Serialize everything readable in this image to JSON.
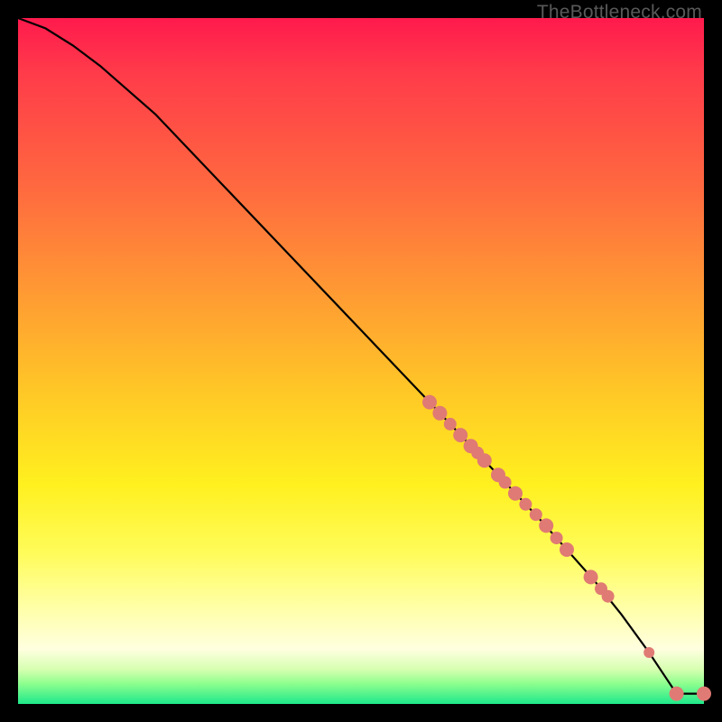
{
  "watermark": "TheBottleneck.com",
  "chart_data": {
    "type": "line",
    "title": "",
    "xlabel": "",
    "ylabel": "",
    "xlim": [
      0,
      100
    ],
    "ylim": [
      0,
      100
    ],
    "curve": {
      "x": [
        0,
        4,
        8,
        12,
        20,
        30,
        40,
        50,
        60,
        68,
        76,
        80,
        84,
        88,
        92,
        94,
        96,
        100
      ],
      "y": [
        100,
        98.5,
        96,
        93,
        86,
        75.5,
        65,
        54.5,
        44,
        35.5,
        27,
        22.5,
        18,
        13,
        7.5,
        4.5,
        1.5,
        1.5
      ]
    },
    "series": [
      {
        "name": "highlight-points",
        "color": "#e07a74",
        "x": [
          60,
          61.5,
          63,
          64.5,
          66,
          67,
          68,
          70,
          71,
          72.5,
          74,
          75.5,
          77,
          78.5,
          80,
          83.5,
          85,
          86,
          92,
          96,
          100
        ],
        "y": [
          44,
          42.4,
          40.8,
          39.2,
          37.6,
          36.6,
          35.5,
          33.4,
          32.3,
          30.7,
          29.1,
          27.6,
          26,
          24.2,
          22.5,
          18.5,
          16.8,
          15.7,
          7.5,
          1.5,
          1.5
        ],
        "r": [
          8,
          8,
          7,
          8,
          8,
          7,
          8,
          8,
          7,
          8,
          7,
          7,
          8,
          7,
          8,
          8,
          7,
          7,
          6,
          8,
          8
        ]
      }
    ]
  }
}
